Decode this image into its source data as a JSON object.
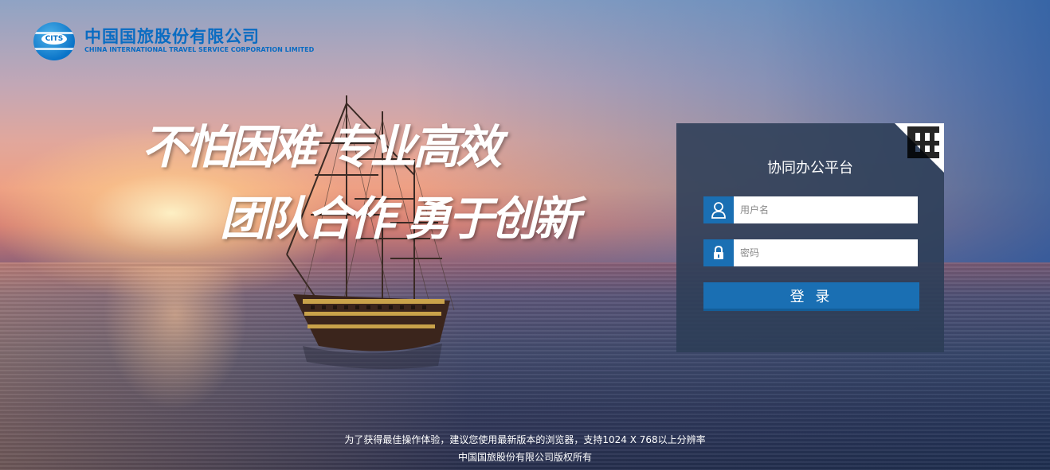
{
  "logo": {
    "badge_text": "CITS",
    "name_cn": "中国国旅股份有限公司",
    "name_en": "CHINA INTERNATIONAL TRAVEL SERVICE CORPORATION LIMITED"
  },
  "slogan": {
    "line1": "不怕困难 专业高效",
    "line2": "团队合作 勇于创新"
  },
  "login": {
    "title": "协同办公平台",
    "username_placeholder": "用户名",
    "password_placeholder": "密码",
    "submit_label": "登 录"
  },
  "footer": {
    "notice": "为了获得最佳操作体验，建议您使用最新版本的浏览器，支持1024 X 768以上分辨率",
    "copyright": "中国国旅股份有限公司版权所有"
  },
  "colors": {
    "accent": "#1a6fb3",
    "panel": "#2c3e56",
    "brand": "#0a6cc2"
  }
}
